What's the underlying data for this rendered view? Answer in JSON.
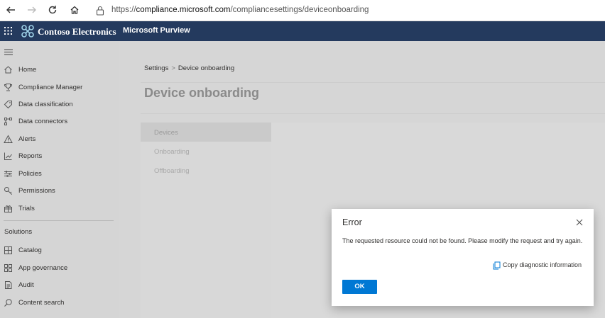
{
  "browser": {
    "url_prefix": "https://",
    "url_host": "compliance.microsoft.com",
    "url_path": "/compliancesettings/deviceonboarding"
  },
  "header": {
    "org_name": "Contoso Electronics",
    "app_name": "Microsoft Purview"
  },
  "sidebar": {
    "items": [
      {
        "label": "Home",
        "icon": "home-icon"
      },
      {
        "label": "Compliance Manager",
        "icon": "trophy-icon"
      },
      {
        "label": "Data classification",
        "icon": "tag-icon"
      },
      {
        "label": "Data connectors",
        "icon": "connector-icon"
      },
      {
        "label": "Alerts",
        "icon": "warning-icon"
      },
      {
        "label": "Reports",
        "icon": "chart-icon"
      },
      {
        "label": "Policies",
        "icon": "sliders-icon"
      },
      {
        "label": "Permissions",
        "icon": "key-icon"
      },
      {
        "label": "Trials",
        "icon": "gift-icon"
      }
    ],
    "section_title": "Solutions",
    "solutions": [
      {
        "label": "Catalog",
        "icon": "grid-icon"
      },
      {
        "label": "App governance",
        "icon": "app-grid-icon"
      },
      {
        "label": "Audit",
        "icon": "document-icon"
      },
      {
        "label": "Content search",
        "icon": "search-icon"
      }
    ]
  },
  "main": {
    "breadcrumb": [
      "Settings",
      "Device onboarding"
    ],
    "breadcrumb_separator": ">",
    "page_title": "Device onboarding",
    "tabs": [
      "Devices",
      "Onboarding",
      "Offboarding"
    ],
    "active_tab": "Devices"
  },
  "dialog": {
    "title": "Error",
    "message": "The requested resource could not be found. Please modify the request and try again.",
    "copy_label": "Copy diagnostic information",
    "ok_label": "OK"
  },
  "colors": {
    "header_bg": "#243a5e",
    "primary_button": "#0078d4",
    "overlay_gray": "#d6d6d6"
  }
}
